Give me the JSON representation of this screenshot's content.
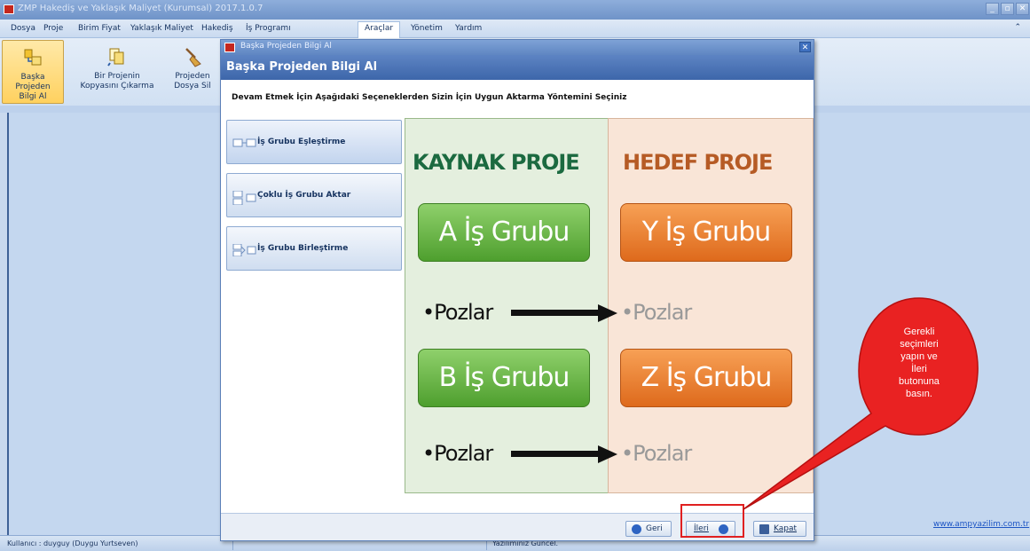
{
  "window": {
    "title": "ZMP Hakediş ve Yaklaşık Maliyet (Kurumsal) 2017.1.0.7"
  },
  "menu": {
    "items": [
      "Dosya",
      "Proje",
      "Birim Fiyat",
      "Yaklaşık Maliyet",
      "Hakediş",
      "İş Programı",
      "Araçlar",
      "Yönetim",
      "Yardım"
    ],
    "active": "Araçlar"
  },
  "ribbon": {
    "buttons": [
      {
        "label1": "Başka Projeden",
        "label2": "Bilgi Al",
        "icon": "import-icon"
      },
      {
        "label1": "Bir Projenin",
        "label2": "Kopyasını Çıkarma",
        "icon": "copy-icon"
      },
      {
        "label1": "Projeden",
        "label2": "Dosya Sil",
        "icon": "broom-icon"
      }
    ]
  },
  "dialog": {
    "title": "Başka Projeden Bilgi Al",
    "header": "Başka Projeden Bilgi Al",
    "instruction": "Devam Etmek İçin Aşağıdaki Seçeneklerden Sizin İçin Uygun Aktarma Yöntemini Seçiniz",
    "options": [
      "İş Grubu Eşleştirme",
      "Çoklu İş Grubu Aktar",
      "İş Grubu Birleştirme"
    ],
    "diagram": {
      "source_title": "KAYNAK PROJE",
      "target_title": "HEDEF PROJE",
      "groups": [
        {
          "source": "A İş Grubu",
          "target": "Y İş Grubu"
        },
        {
          "source": "B İş Grubu",
          "target": "Z İş Grubu"
        }
      ],
      "item_label": "•Pozlar",
      "colors": {
        "source": "#5aa938",
        "target": "#e9782a"
      }
    },
    "footer": {
      "back": "Geri",
      "next": "İleri",
      "close": "Kapat"
    }
  },
  "callout": {
    "text": "Gerekli seçimleri yapın ve İleri butonuna basın.",
    "lines": [
      "Gerekli",
      "seçimleri",
      "yapın ve",
      "İleri",
      "butonuna",
      "basın."
    ]
  },
  "website": "www.ampyazilim.com.tr",
  "status": {
    "user": "Kullanıcı : duyguy  (Duygu Yurtseven)",
    "update": "Yazılımınız Güncel."
  }
}
